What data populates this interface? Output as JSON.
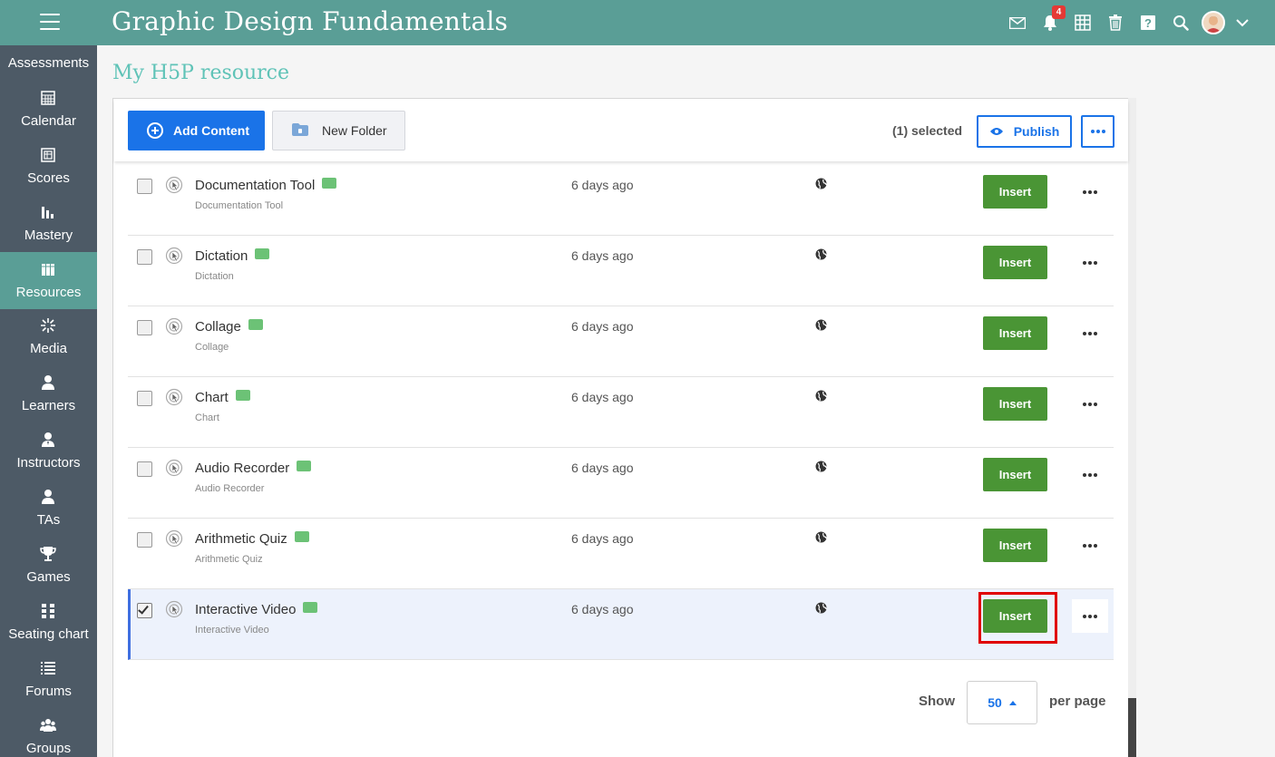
{
  "header": {
    "title": "Graphic Design Fundamentals",
    "notification_count": "4",
    "colors": {
      "bar": "#5a9e96"
    }
  },
  "sidebar": {
    "items": [
      {
        "label": "Assessments",
        "icon": "clipboard-icon"
      },
      {
        "label": "Calendar",
        "icon": "calendar-icon"
      },
      {
        "label": "Scores",
        "icon": "scores-icon"
      },
      {
        "label": "Mastery",
        "icon": "bar-chart-icon"
      },
      {
        "label": "Resources",
        "icon": "books-icon",
        "active": true
      },
      {
        "label": "Media",
        "icon": "media-icon"
      },
      {
        "label": "Learners",
        "icon": "person-icon"
      },
      {
        "label": "Instructors",
        "icon": "instructor-icon"
      },
      {
        "label": "TAs",
        "icon": "ta-icon"
      },
      {
        "label": "Games",
        "icon": "trophy-icon"
      },
      {
        "label": "Seating chart",
        "icon": "seating-icon"
      },
      {
        "label": "Forums",
        "icon": "list-icon"
      },
      {
        "label": "Groups",
        "icon": "group-icon"
      }
    ]
  },
  "page": {
    "title": "My H5P resource"
  },
  "toolbar": {
    "add_label": "Add Content",
    "folder_label": "New Folder",
    "selected_text": "(1) selected",
    "publish_label": "Publish"
  },
  "rows": [
    {
      "title": "Documentation Tool",
      "subtitle": "Documentation Tool",
      "date": "6 days ago",
      "action": "Insert",
      "checked": false
    },
    {
      "title": "Dictation",
      "subtitle": "Dictation",
      "date": "6 days ago",
      "action": "Insert",
      "checked": false
    },
    {
      "title": "Collage",
      "subtitle": "Collage",
      "date": "6 days ago",
      "action": "Insert",
      "checked": false
    },
    {
      "title": "Chart",
      "subtitle": "Chart",
      "date": "6 days ago",
      "action": "Insert",
      "checked": false
    },
    {
      "title": "Audio Recorder",
      "subtitle": "Audio Recorder",
      "date": "6 days ago",
      "action": "Insert",
      "checked": false
    },
    {
      "title": "Arithmetic Quiz",
      "subtitle": "Arithmetic Quiz",
      "date": "6 days ago",
      "action": "Insert",
      "checked": false
    },
    {
      "title": "Interactive Video",
      "subtitle": "Interactive Video",
      "date": "6 days ago",
      "action": "Insert",
      "checked": true
    }
  ],
  "pagination": {
    "show_label": "Show",
    "per_page_value": "50",
    "per_page_label": "per page"
  }
}
